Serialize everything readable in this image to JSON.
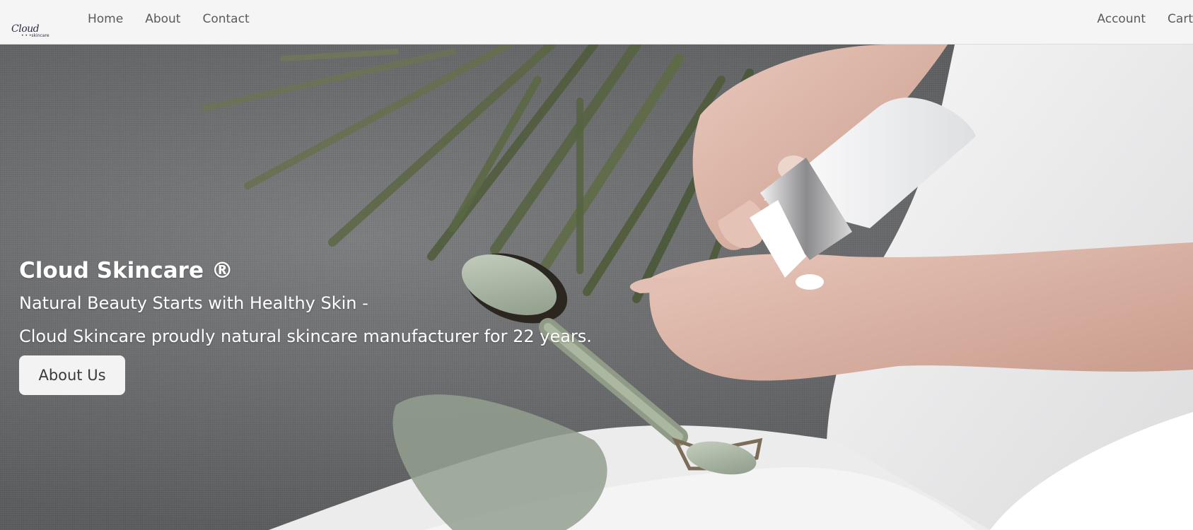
{
  "brand": {
    "logo_script": "Cloud",
    "logo_sub": "• • •skincare"
  },
  "nav": {
    "left": [
      {
        "label": "Home"
      },
      {
        "label": "About"
      },
      {
        "label": "Contact"
      }
    ],
    "right": [
      {
        "label": "Account"
      },
      {
        "label": "Cart"
      }
    ]
  },
  "hero": {
    "title": "Cloud Skincare ®",
    "subtitle": "Natural Beauty Starts with Healthy Skin -",
    "tagline": "Cloud Skincare proudly natural skincare manufacturer for 22 years.",
    "button_label": "About Us"
  },
  "colors": {
    "navbar_bg": "#f5f5f5",
    "nav_text": "#5a5a5a",
    "hero_text": "#ffffff",
    "button_bg": "#f3f3f3",
    "button_text": "#3a3a3a"
  }
}
